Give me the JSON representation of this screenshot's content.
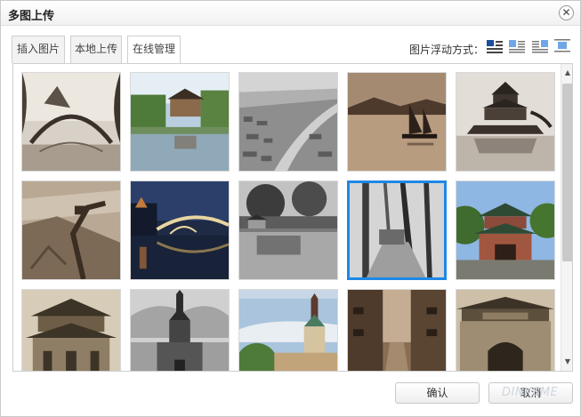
{
  "dialog": {
    "title": "多图上传",
    "close_glyph": "✕"
  },
  "tabs": [
    {
      "label": "插入图片"
    },
    {
      "label": "本地上传"
    },
    {
      "label": "在线管理",
      "active": true
    }
  ],
  "float_options": {
    "label": "图片浮动方式：",
    "icons": [
      "float-none-icon",
      "float-left-icon",
      "float-right-icon",
      "float-center-icon"
    ],
    "selected": "float-none-icon"
  },
  "gallery": {
    "selected_index": 8,
    "images": [
      {
        "icon": "arch-bridge-photo"
      },
      {
        "icon": "pavilion-pond-photo"
      },
      {
        "icon": "aerial-river-town-photo"
      },
      {
        "icon": "sailboat-lake-photo"
      },
      {
        "icon": "temple-island-photo"
      },
      {
        "icon": "great-wall-photo"
      },
      {
        "icon": "night-bridge-photo"
      },
      {
        "icon": "pond-trees-photo"
      },
      {
        "icon": "forest-path-photo"
      },
      {
        "icon": "pagoda-gate-photo"
      },
      {
        "icon": "temple-roof-photo"
      },
      {
        "icon": "cathedral-bw-photo"
      },
      {
        "icon": "church-color-photo"
      },
      {
        "icon": "old-street-photo"
      },
      {
        "icon": "city-gate-photo"
      }
    ]
  },
  "scrollbar": {
    "up_glyph": "▲",
    "down_glyph": "▼"
  },
  "buttons": {
    "ok_label": "确认",
    "cancel_label": "取消"
  },
  "watermark": "DINKSME",
  "colors": {
    "selection": "#1e88e5"
  }
}
